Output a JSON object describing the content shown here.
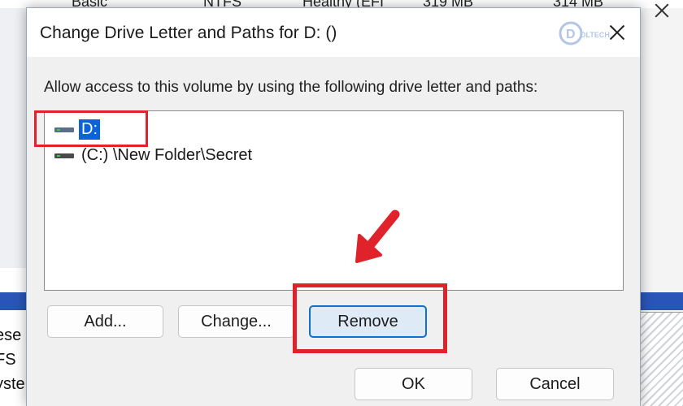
{
  "background": {
    "top_row": [
      "Basic",
      "NTFS",
      "Healthy (EFI",
      "319 MB",
      "314 MB"
    ],
    "left_lines": [
      "ese",
      "FS",
      "yste"
    ]
  },
  "dialog": {
    "title": "Change Drive Letter and Paths for D: ()",
    "watermark": "DLTECH",
    "instruction": "Allow access to this volume by using the following drive letter and paths:",
    "list_items": [
      {
        "label": "D:",
        "selected": true
      },
      {
        "label": "(C:) \\New Folder\\Secret",
        "selected": false
      }
    ],
    "buttons": {
      "add": "Add...",
      "change": "Change...",
      "remove": "Remove",
      "ok": "OK",
      "cancel": "Cancel"
    }
  },
  "colors": {
    "highlight": "#e0232a",
    "selection": "#0a64d8",
    "focus_border": "#0f6fcf"
  }
}
